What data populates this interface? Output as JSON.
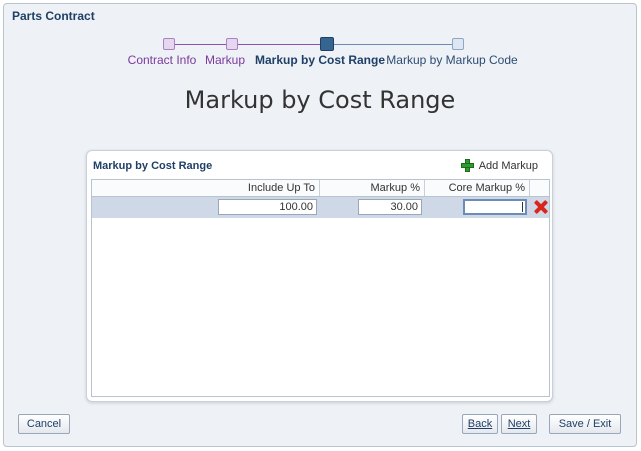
{
  "window": {
    "title": "Parts Contract"
  },
  "train": {
    "steps": [
      {
        "label": "Contract Info",
        "state": "visited"
      },
      {
        "label": "Markup",
        "state": "visited"
      },
      {
        "label": "Markup by Cost Range",
        "state": "current"
      },
      {
        "label": "Markup by Markup Code",
        "state": "upcoming"
      }
    ]
  },
  "page": {
    "heading": "Markup by Cost Range"
  },
  "panel": {
    "title": "Markup by Cost Range",
    "add_label": "Add Markup",
    "add_icon": "plus-icon",
    "columns": [
      "Include Up To",
      "Markup %",
      "Core Markup %"
    ],
    "rows": [
      {
        "include_up_to": "100.00",
        "markup_pct": "30.00",
        "core_markup_pct": ""
      }
    ],
    "delete_icon": "delete-x-icon"
  },
  "footer": {
    "cancel_label": "Cancel",
    "back_label": "Back",
    "next_label": "Next",
    "save_exit_label": "Save / Exit"
  },
  "colors": {
    "visited": "#7a3a9c",
    "current": "#1f3f66",
    "row_selected": "#cfd8e6",
    "delete": "#d9261c",
    "add": "#2e9b2e"
  }
}
